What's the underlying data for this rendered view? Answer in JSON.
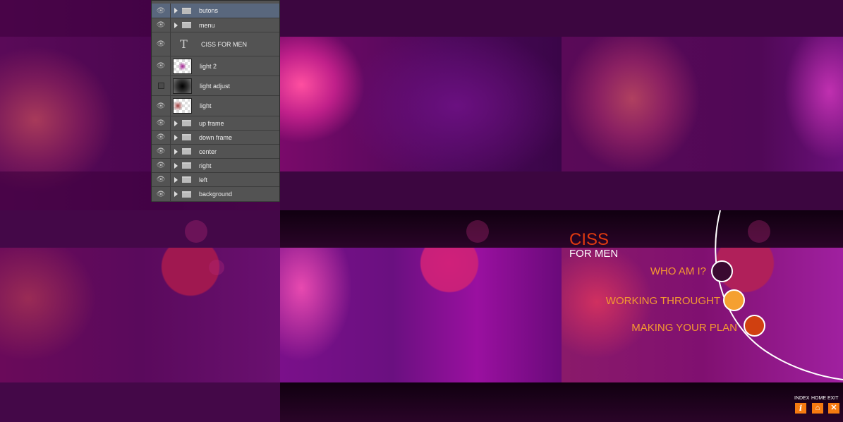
{
  "layers_panel": {
    "layers": [
      {
        "name": "butons",
        "type": "group",
        "visible": true,
        "selected": true
      },
      {
        "name": "menu",
        "type": "group",
        "visible": true
      },
      {
        "name": "CISS FOR MEN",
        "type": "text",
        "visible": true
      },
      {
        "name": "light 2",
        "type": "pixel",
        "visible": true
      },
      {
        "name": "light adjust",
        "type": "pixel",
        "visible": false
      },
      {
        "name": "light",
        "type": "pixel",
        "visible": true
      },
      {
        "name": "up frame",
        "type": "group",
        "visible": true
      },
      {
        "name": "down frame",
        "type": "group",
        "visible": true
      },
      {
        "name": "center",
        "type": "group",
        "visible": true
      },
      {
        "name": "right",
        "type": "group",
        "visible": true
      },
      {
        "name": "left",
        "type": "group",
        "visible": true
      },
      {
        "name": "background",
        "type": "group",
        "visible": true
      }
    ]
  },
  "design": {
    "title": "CISS",
    "subtitle": "FOR MEN",
    "menu": [
      "WHO AM I?",
      "WORKING THROUGHT",
      "MAKING YOUR PLAN"
    ],
    "menu_dot_colors": [
      "#3a0a30",
      "#f5a030",
      "#d04010"
    ],
    "nav": [
      {
        "label": "INDEX",
        "glyph": "i"
      },
      {
        "label": "HOME",
        "glyph": "⌂"
      },
      {
        "label": "EXIT",
        "glyph": "✕"
      }
    ],
    "accent": "#f59a30",
    "title_color": "#e03a10"
  }
}
